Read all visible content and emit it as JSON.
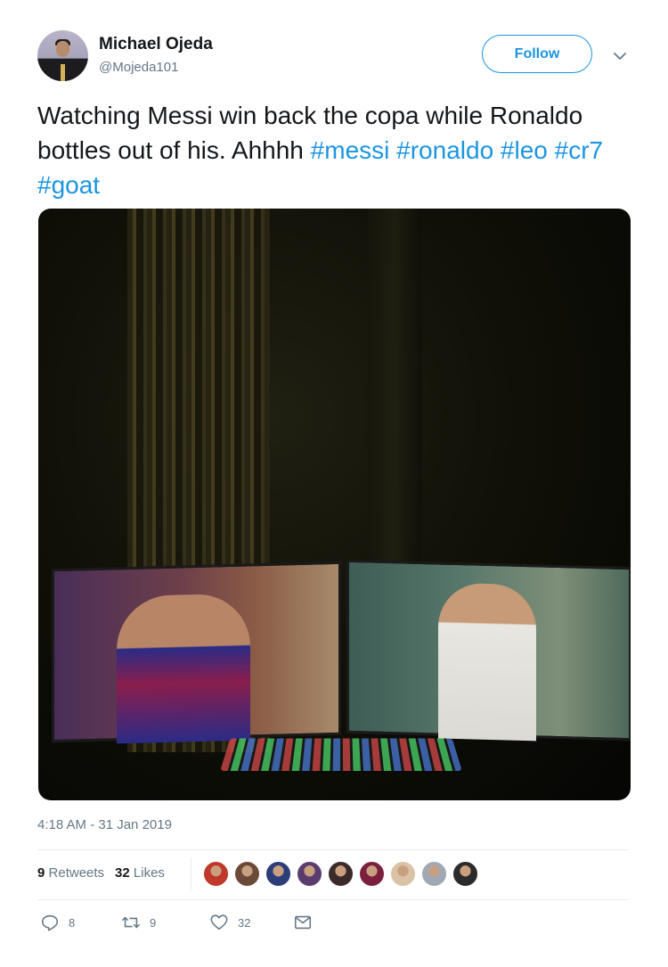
{
  "user": {
    "name": "Michael Ojeda",
    "handle": "@Mojeda101"
  },
  "follow_label": "Follow",
  "tweet": {
    "text_plain": "Watching Messi win back the copa while Ronaldo bottles out of his. Ahhhh",
    "hashtags": [
      "#messi",
      "#ronaldo",
      "#leo",
      "#cr7",
      "#goat"
    ]
  },
  "timestamp": "4:18 AM - 31 Jan 2019",
  "stats": {
    "retweets_count": "9",
    "retweets_label": "Retweets",
    "likes_count": "32",
    "likes_label": "Likes"
  },
  "liker_avatars": [
    "#c0392b",
    "#6b4a3a",
    "#2c3e7a",
    "#5a3d6e",
    "#3b2a2a",
    "#7a1f3d",
    "#d9c2a5",
    "#a0a8b5",
    "#2b2b2b"
  ],
  "actions": {
    "reply_count": "8",
    "retweet_count": "9",
    "like_count": "32"
  },
  "colors": {
    "accent": "#1b95e0",
    "muted": "#657786",
    "text": "#14171a"
  }
}
